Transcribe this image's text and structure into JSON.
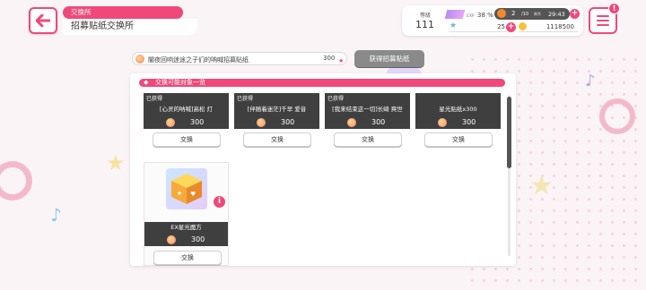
{
  "header": {
    "breadcrumb": "交换所",
    "title": "招募贴纸交换所"
  },
  "status": {
    "level_label": "等级",
    "level": "111",
    "exp_label": "EXP",
    "exp_percent": "38 %",
    "stamina_current": "2",
    "stamina_max": "/10",
    "stamina_sublabel": "剩余",
    "stamina_timer": "29:43",
    "stars": "25",
    "coins": "1118500",
    "notification": "!"
  },
  "ticket": {
    "name": "闇夜回响迷途之子们的呐喊招募贴纸",
    "count": "300",
    "get_button": "获得招募贴纸"
  },
  "panel": {
    "header": "交换可能对象一览"
  },
  "items": [
    {
      "status": "已获得",
      "name": "[心灵的呐喊]高松 灯",
      "price": "300",
      "button": "交换"
    },
    {
      "status": "已获得",
      "name": "[伴随着迷茫]千早 爱音",
      "price": "300",
      "button": "交换"
    },
    {
      "status": "已获得",
      "name": "[我来结束这一切]长崎 爽世",
      "price": "300",
      "button": "交换"
    },
    {
      "status": "",
      "name": "星光贴纸x300",
      "price": "300",
      "button": "交换"
    },
    {
      "status": "",
      "name": "EX星光魔方",
      "price": "300",
      "button": "交换"
    }
  ],
  "colors": {
    "accent": "#f0487a",
    "card_dark": "#3f3f3f",
    "button_gray": "#8a8a8a"
  },
  "icons": {
    "back": "arrow-left-icon",
    "menu": "hamburger-icon",
    "ticket": "ticket-orb-icon",
    "star": "star-icon",
    "coin": "coin-icon",
    "stamina": "flame-icon"
  }
}
